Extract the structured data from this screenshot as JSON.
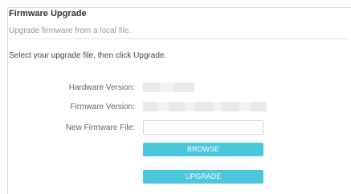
{
  "section": {
    "title": "Firmware Upgrade",
    "subtitle": "Upgrade firmware from a local file."
  },
  "form": {
    "instruction": "Select your upgrade file, then click Upgrade.",
    "hardware_version_label": "Hardware Version:",
    "firmware_version_label": "Firmware Version:",
    "new_firmware_file_label": "New Firmware File:",
    "new_firmware_file_value": "",
    "browse_label": "BROWSE",
    "upgrade_label": "UPGRADE"
  },
  "colors": {
    "accent": "#4ac6dd",
    "redaction": "#e9e9e9"
  }
}
